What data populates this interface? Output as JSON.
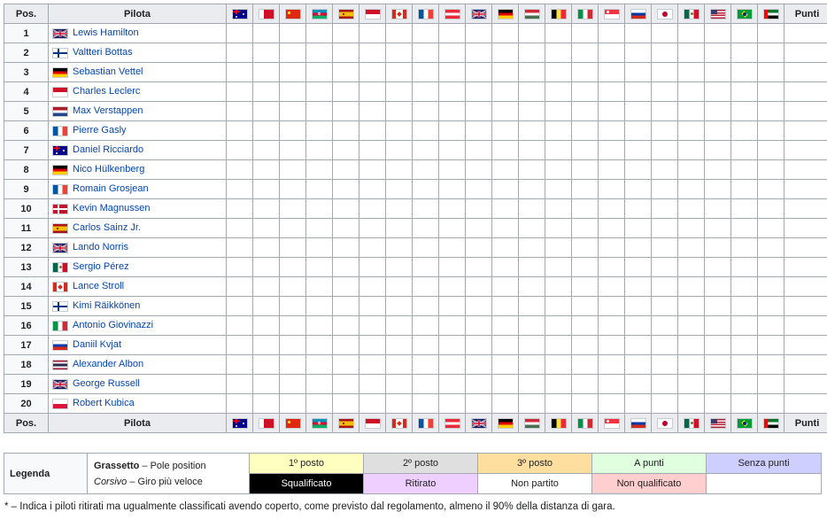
{
  "header": {
    "pos": "Pos.",
    "driver": "Pilota",
    "points": "Punti",
    "races": [
      {
        "flag": "australia-flag"
      },
      {
        "flag": "bahrain-flag"
      },
      {
        "flag": "china-flag"
      },
      {
        "flag": "azerbaijan-flag"
      },
      {
        "flag": "spain-flag"
      },
      {
        "flag": "monaco-flag"
      },
      {
        "flag": "canada-flag"
      },
      {
        "flag": "france-flag"
      },
      {
        "flag": "austria-flag"
      },
      {
        "flag": "great-britain-flag"
      },
      {
        "flag": "germany-flag"
      },
      {
        "flag": "hungary-flag"
      },
      {
        "flag": "belgium-flag"
      },
      {
        "flag": "italy-flag"
      },
      {
        "flag": "singapore-flag"
      },
      {
        "flag": "russia-flag"
      },
      {
        "flag": "japan-flag"
      },
      {
        "flag": "mexico-flag"
      },
      {
        "flag": "united-states-flag"
      },
      {
        "flag": "brazil-flag"
      },
      {
        "flag": "abu-dhabi-flag"
      }
    ]
  },
  "drivers": [
    {
      "pos": "1",
      "name": "Lewis Hamilton",
      "flag": "great-britain-flag"
    },
    {
      "pos": "2",
      "name": "Valtteri Bottas",
      "flag": "finland-flag"
    },
    {
      "pos": "3",
      "name": "Sebastian Vettel",
      "flag": "germany-flag"
    },
    {
      "pos": "4",
      "name": "Charles Leclerc",
      "flag": "monaco-flag"
    },
    {
      "pos": "5",
      "name": "Max Verstappen",
      "flag": "netherlands-flag"
    },
    {
      "pos": "6",
      "name": "Pierre Gasly",
      "flag": "france-flag"
    },
    {
      "pos": "7",
      "name": "Daniel Ricciardo",
      "flag": "australia-flag"
    },
    {
      "pos": "8",
      "name": "Nico Hülkenberg",
      "flag": "germany-flag"
    },
    {
      "pos": "9",
      "name": "Romain Grosjean",
      "flag": "france-flag"
    },
    {
      "pos": "10",
      "name": "Kevin Magnussen",
      "flag": "denmark-flag"
    },
    {
      "pos": "11",
      "name": "Carlos Sainz Jr.",
      "flag": "spain-flag"
    },
    {
      "pos": "12",
      "name": "Lando Norris",
      "flag": "great-britain-flag"
    },
    {
      "pos": "13",
      "name": "Sergio Pérez",
      "flag": "mexico-flag"
    },
    {
      "pos": "14",
      "name": "Lance Stroll",
      "flag": "canada-flag"
    },
    {
      "pos": "15",
      "name": "Kimi Räikkönen",
      "flag": "finland-flag"
    },
    {
      "pos": "16",
      "name": "Antonio Giovinazzi",
      "flag": "italy-flag"
    },
    {
      "pos": "17",
      "name": "Daniil Kvjat",
      "flag": "russia-flag"
    },
    {
      "pos": "18",
      "name": "Alexander Albon",
      "flag": "thailand-flag"
    },
    {
      "pos": "19",
      "name": "George Russell",
      "flag": "great-britain-flag"
    },
    {
      "pos": "20",
      "name": "Robert Kubica",
      "flag": "poland-flag"
    }
  ],
  "legend": {
    "title": "Legenda",
    "bold_label": "Grassetto",
    "bold_desc": " – Pole position",
    "italic_label": "Corsivo",
    "italic_desc": " – Giro più veloce",
    "row1": [
      {
        "label": "1º posto",
        "bg": "#ffffbf",
        "color": "#202122"
      },
      {
        "label": "2º posto",
        "bg": "#dfdfdf",
        "color": "#202122"
      },
      {
        "label": "3º posto",
        "bg": "#ffdf9f",
        "color": "#202122"
      },
      {
        "label": "A punti",
        "bg": "#dfffdf",
        "color": "#202122"
      },
      {
        "label": "Senza punti",
        "bg": "#cfcfff",
        "color": "#202122"
      }
    ],
    "row2": [
      {
        "label": "Squalificato",
        "bg": "#000000",
        "color": "#ffffff"
      },
      {
        "label": "Ritirato",
        "bg": "#efcfff",
        "color": "#202122"
      },
      {
        "label": "Non partito",
        "bg": "#ffffff",
        "color": "#202122"
      },
      {
        "label": "Non qualificato",
        "bg": "#ffcfcf",
        "color": "#202122"
      },
      {
        "label": "",
        "bg": "#ffffff",
        "color": "#202122"
      }
    ]
  },
  "footnote": "* – Indica i piloti ritirati ma ugualmente classificati avendo coperto, come previsto dal regolamento, almeno il 90% della distanza di gara."
}
